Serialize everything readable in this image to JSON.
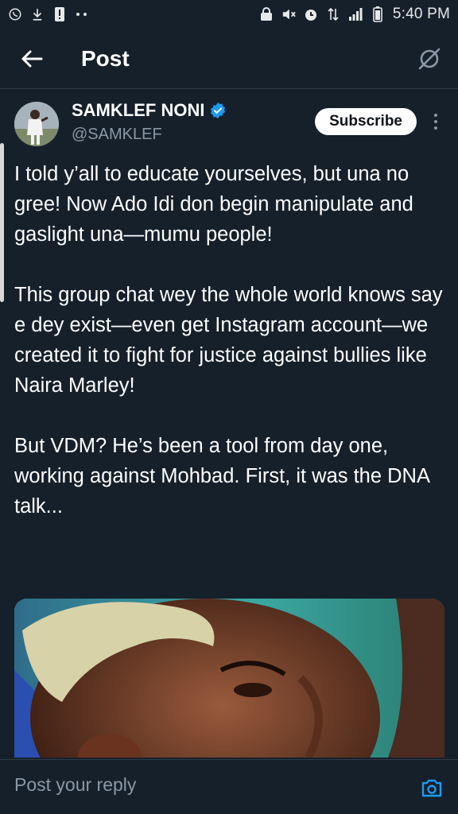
{
  "status_bar": {
    "time": "5:40 PM",
    "left_icons": [
      "whatsapp-icon",
      "download-icon",
      "alert-icon",
      "more-dots-icon"
    ],
    "right_icons": [
      "lock-icon",
      "mute-icon",
      "alarm-icon",
      "data-icon",
      "signal-icon",
      "battery-icon"
    ]
  },
  "header": {
    "title": "Post"
  },
  "author": {
    "name": "SAMKLEF NONI",
    "handle": "@SAMKLEF",
    "verified": true,
    "subscribe_label": "Subscribe"
  },
  "post": {
    "paragraphs": [
      "I told y’all to educate yourselves, but una no gree! Now Ado Idi don begin manipulate and gaslight una—mumu people!",
      "This group chat wey the whole world knows say e dey exist—even get Instagram account—we created it to fight for justice against bullies like Naira Marley!",
      "But VDM? He’s been a tool from day one, working against Mohbad. First, it was the DNA talk..."
    ]
  },
  "reply": {
    "placeholder": "Post your reply"
  },
  "colors": {
    "background": "#15202b",
    "accent": "#1d9bf0",
    "secondary_text": "#8b98a5"
  }
}
